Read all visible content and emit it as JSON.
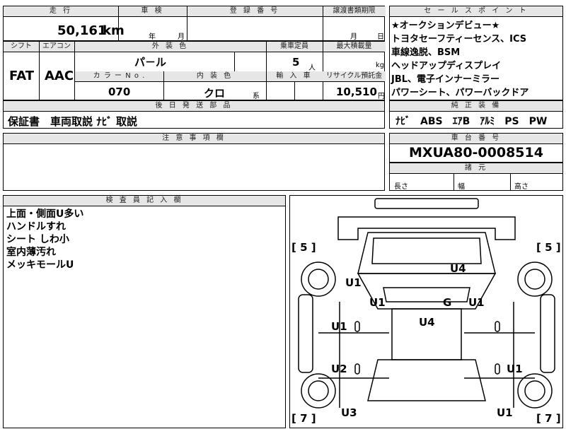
{
  "top": {
    "mileage_header": "走 行",
    "inspection_header": "車 検",
    "registration_header": "登 録 番 号",
    "transfer_header": "譲渡書類期限",
    "mileage_value": "50,161",
    "mileage_unit": "km",
    "insp_year": "年",
    "insp_month": "月",
    "transfer_month": "月",
    "transfer_day": "日"
  },
  "row2": {
    "shift_header": "シフト",
    "ac_header": "エアコン",
    "color_header": "外 装 色",
    "capacity_header": "乗車定員",
    "maxload_header": "最大積載量",
    "shift_value": "FAT",
    "ac_value": "AAC",
    "color_value": "パ－ル",
    "capacity_value": "5",
    "capacity_unit": "人",
    "maxload_unit": "kg"
  },
  "row3": {
    "colorno_header": "カ ラ ー N o .",
    "interior_header": "内 装 色",
    "import_header": "輸 入 車",
    "recycle_header": "リサイクル預託金",
    "colorno_value": "070",
    "interior_value": "クロ",
    "interior_suffix": "系",
    "recycle_value": "10,510",
    "recycle_unit": "円"
  },
  "later": {
    "header": "後 日 発 送 部 品",
    "value": "保証書　車両取説 ﾅﾋﾞ 取説"
  },
  "notes": {
    "header": "注 意 事 項 欄"
  },
  "sales": {
    "header": "セ ー ル ス ポ イ ン ト",
    "lines": [
      "★オークションデビュー★",
      "トヨタセーフティーセンス、ICS",
      "車線逸脱、BSM",
      "ヘッドアップディスプレイ",
      "JBL、電子インナーミラー",
      "パワーシート、パワーバックドア"
    ]
  },
  "equipment": {
    "header": "純 正 装 備",
    "value": "ﾅﾋﾞ　ABS　ｴｱB　ｱﾙﾐ　PS　PW"
  },
  "chassis": {
    "header": "車 台 番 号",
    "value": "MXUA80-0008514"
  },
  "dims": {
    "header": "諸 元",
    "length": "長さ",
    "width": "幅",
    "height": "高さ"
  },
  "inspector": {
    "header": "検 査 員 記 入 欄",
    "lines": [
      "上面・側面U多い",
      "ハンドルすれ",
      "シート しわ小",
      "室内薄汚れ",
      "メッキモールU"
    ]
  },
  "diagram": {
    "marks": {
      "left_top": "[ 5 ]",
      "right_top": "[ 5 ]",
      "left_bottom": "[ 7 ]",
      "right_bottom": "[ 7 ]",
      "u4_top": "U4",
      "u1_left_upper": "U1",
      "u1_left_mid": "U1",
      "g": "G",
      "u1_right_mid": "U1",
      "u4_center": "U4",
      "u1_left_door": "U1",
      "u2_left": "U2",
      "u1_right_door": "U1",
      "u3_left": "U3",
      "u1_right_bottom": "U1"
    }
  }
}
